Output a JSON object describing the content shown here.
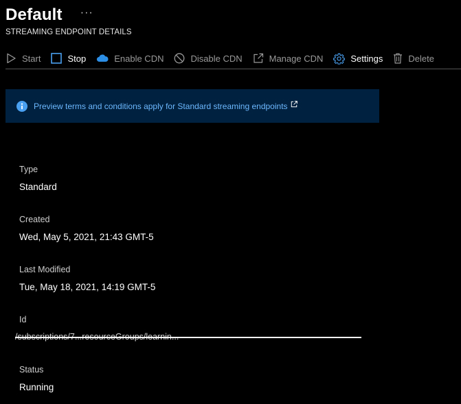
{
  "header": {
    "title": "Default",
    "more": "···",
    "subtitle": "STREAMING ENDPOINT DETAILS"
  },
  "toolbar": {
    "start": "Start",
    "stop": "Stop",
    "enable_cdn": "Enable CDN",
    "disable_cdn": "Disable CDN",
    "manage_cdn": "Manage CDN",
    "settings": "Settings",
    "delete": "Delete"
  },
  "banner": {
    "text": "Preview terms and conditions apply for Standard streaming endpoints"
  },
  "details": {
    "type_label": "Type",
    "type_value": "Standard",
    "created_label": "Created",
    "created_value": "Wed, May 5, 2021, 21:43 GMT-5",
    "modified_label": "Last Modified",
    "modified_value": "Tue, May 18, 2021, 14:19 GMT-5",
    "id_label": "Id",
    "id_value": "/subscriptions/7...resourceGroups/learnin...",
    "status_label": "Status",
    "status_value": "Running"
  },
  "colors": {
    "accent_blue": "#4aa0f0",
    "link_blue": "#6cb8ff",
    "banner_bg": "#00213f"
  }
}
